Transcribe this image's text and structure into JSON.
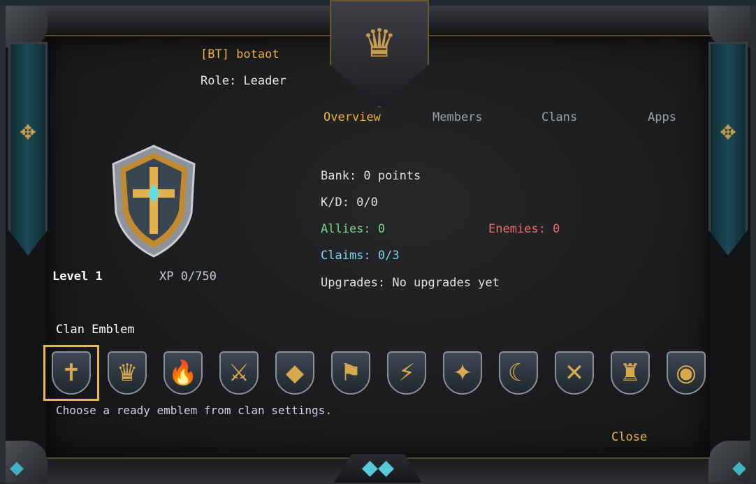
{
  "header": {
    "player_name": "[BT] botaot",
    "role": "Role: Leader"
  },
  "tabs": [
    {
      "label": "Overview",
      "active": true
    },
    {
      "label": "Members",
      "active": false
    },
    {
      "label": "Clans",
      "active": false
    },
    {
      "label": "Apps",
      "active": false
    }
  ],
  "profile": {
    "level": "Level 1",
    "xp": "XP 0/750"
  },
  "stats": {
    "bank": "Bank: 0 points",
    "kd": "K/D: 0/0",
    "allies": "Allies: 0",
    "enemies": "Enemies: 0",
    "claims": "Claims: 0/3",
    "upgrades": "Upgrades: No upgrades yet"
  },
  "emblems": {
    "title": "Clan Emblem",
    "hint": "Choose a ready emblem from clan settings.",
    "selected_index": 0,
    "items": [
      {
        "icon": "shield-cross-icon",
        "glyph": "✝"
      },
      {
        "icon": "crown-icon",
        "glyph": "♛"
      },
      {
        "icon": "flame-icon",
        "glyph": "🔥"
      },
      {
        "icon": "crossed-swords-icon",
        "glyph": "⚔"
      },
      {
        "icon": "crystal-icon",
        "glyph": "◆"
      },
      {
        "icon": "banner-icon",
        "glyph": "⚑"
      },
      {
        "icon": "lightning-icon",
        "glyph": "⚡"
      },
      {
        "icon": "compass-star-icon",
        "glyph": "✦"
      },
      {
        "icon": "crescent-moon-icon",
        "glyph": "☾"
      },
      {
        "icon": "crossed-blades-icon",
        "glyph": "✕"
      },
      {
        "icon": "helmet-icon",
        "glyph": "♜"
      },
      {
        "icon": "eye-icon",
        "glyph": "◉"
      }
    ]
  },
  "actions": {
    "close_label": "Close"
  },
  "colors": {
    "accent_gold": "#f2b233",
    "allies_green": "#7fd48a",
    "enemies_red": "#ef6b6b",
    "claims_blue": "#7fd3f0"
  }
}
